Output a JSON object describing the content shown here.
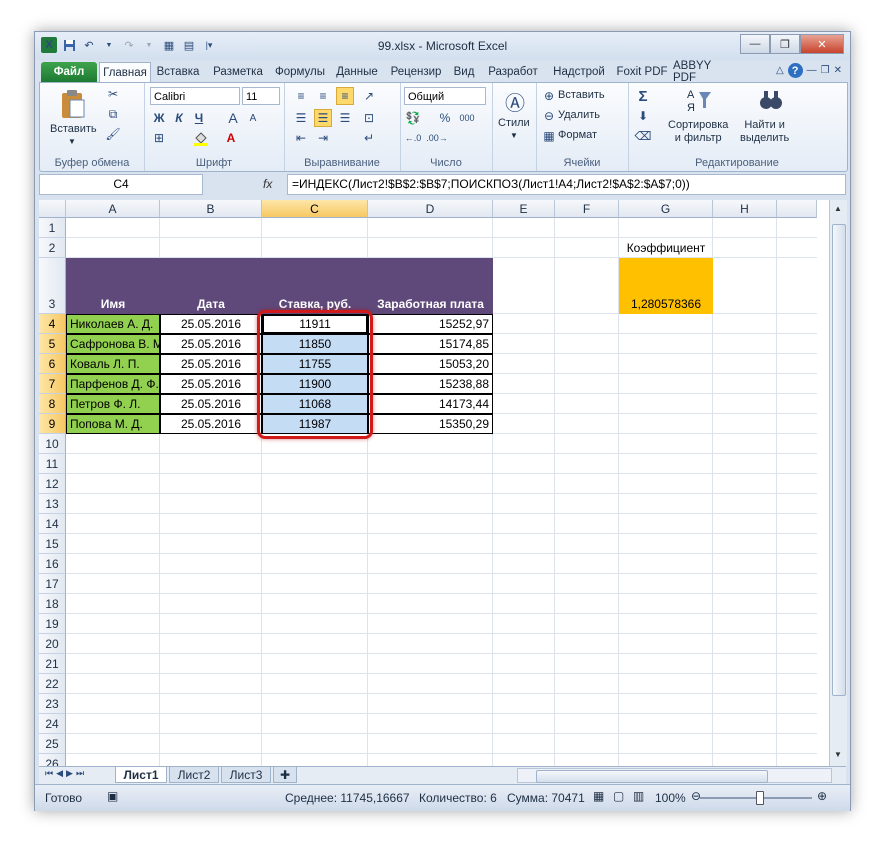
{
  "window": {
    "title": "99.xlsx  -  Microsoft Excel",
    "buttons": {
      "minimize": "—",
      "restore": "❐",
      "close": "✕"
    }
  },
  "qat": {
    "icons": [
      "excel-icon",
      "save-icon",
      "undo-icon",
      "redo-icon",
      "form-icon",
      "table-icon",
      "customize-icon"
    ]
  },
  "tabs": [
    "Файл",
    "Главная",
    "Вставка",
    "Разметка",
    "Формулы",
    "Данные",
    "Рецензир",
    "Вид",
    "Разработ",
    "Надстрой",
    "Foxit PDF",
    "ABBYY PDF"
  ],
  "ribbon": {
    "clipboard": {
      "paste": "Вставить",
      "label": "Буфер обмена"
    },
    "font": {
      "name": "Calibri",
      "size": "11",
      "bold": "Ж",
      "italic": "К",
      "underline": "Ч",
      "grow": "A",
      "shrink": "A",
      "color_letter": "A",
      "label": "Шрифт"
    },
    "alignment": {
      "label": "Выравнивание"
    },
    "number": {
      "format": "Общий",
      "percent": "%",
      "thousands": "000",
      "label": "Число"
    },
    "styles": {
      "label": "Стили"
    },
    "cells": {
      "insert": "Вставить",
      "delete": "Удалить",
      "format": "Формат",
      "label": "Ячейки"
    },
    "editing": {
      "sigma": "Σ",
      "sort_line1": "Сортировка",
      "sort_line2": "и фильтр",
      "find_line1": "Найти и",
      "find_line2": "выделить",
      "label": "Редактирование"
    }
  },
  "formula_bar": {
    "name_box": "C4",
    "fx": "fx",
    "formula": "=ИНДЕКС(Лист2!$B$2:$B$7;ПОИСКПОЗ(Лист1!A4;Лист2!$A$2:$A$7;0))"
  },
  "grid": {
    "columns": [
      "A",
      "B",
      "C",
      "D",
      "E",
      "F",
      "G",
      "H"
    ],
    "rows": [
      "1",
      "2",
      "3",
      "4",
      "5",
      "6",
      "7",
      "8",
      "9",
      "10",
      "11",
      "12",
      "13",
      "14",
      "15",
      "16",
      "17",
      "18",
      "19",
      "20",
      "21",
      "22",
      "23",
      "24",
      "25",
      "26"
    ],
    "coefficient_label": "Коэффициент",
    "coefficient_value": "1,280578366",
    "headers": [
      "Имя",
      "Дата",
      "Ставка, руб.",
      "Заработная плата"
    ],
    "data": [
      [
        "Николаев А. Д.",
        "25.05.2016",
        "11911",
        "15252,97"
      ],
      [
        "Сафронова В. М.",
        "25.05.2016",
        "11850",
        "15174,85"
      ],
      [
        "Коваль Л. П.",
        "25.05.2016",
        "11755",
        "15053,20"
      ],
      [
        "Парфенов Д. Ф.",
        "25.05.2016",
        "11900",
        "15238,88"
      ],
      [
        "Петров Ф. Л.",
        "25.05.2016",
        "11068",
        "14173,44"
      ],
      [
        "Попова М. Д.",
        "25.05.2016",
        "11987",
        "15350,29"
      ]
    ],
    "colors": {
      "header_bg": "#5f497a",
      "name_bg": "#92d050",
      "coef_bg": "#ffc000",
      "selection_bg": "#c5dcf5",
      "highlight": "#d11a1a"
    }
  },
  "sheet_tabs": [
    "Лист1",
    "Лист2",
    "Лист3"
  ],
  "status": {
    "ready": "Готово",
    "average": "Среднее: 11745,16667",
    "count": "Количество: 6",
    "sum": "Сумма: 70471",
    "zoom": "100%"
  }
}
